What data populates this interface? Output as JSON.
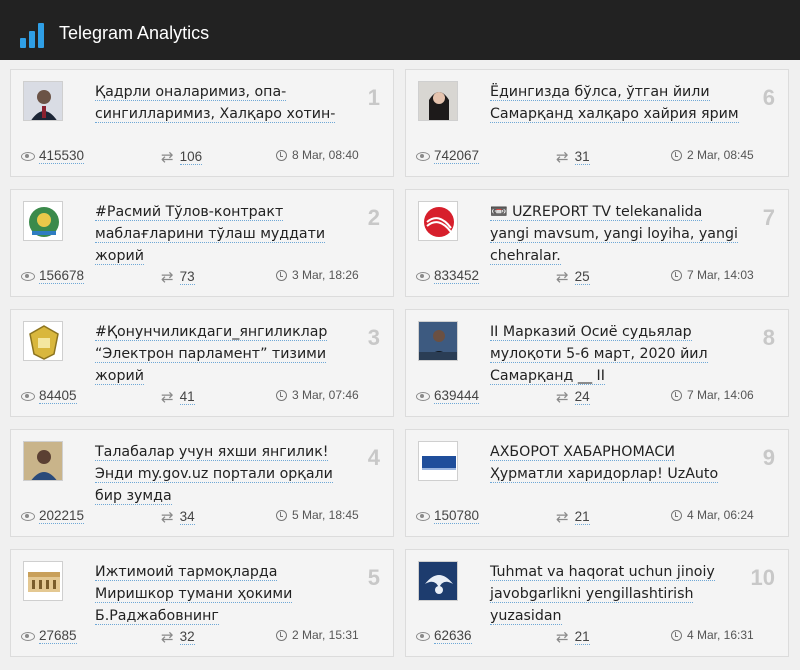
{
  "app": {
    "title": "Telegram Analytics",
    "icon": "bar-chart-icon",
    "accent": "#2f9fe6"
  },
  "posts": [
    {
      "rank": "1",
      "title": "Қадрли оналаримиз, опа-сингилларимиз, Халқаро хотин-",
      "views": "415530",
      "shares": "106",
      "date": "8 Mar, 08:40",
      "thumb": "portrait-photo"
    },
    {
      "rank": "2",
      "title": "#Расмий Тўлов-контракт маблағларини тўлаш муддати жорий",
      "views": "156678",
      "shares": "73",
      "date": "3 Mar, 18:26",
      "thumb": "emblem"
    },
    {
      "rank": "3",
      "title": "#Қонунчиликдаги_янгиликлар “Электрон парламент” тизими жорий",
      "views": "84405",
      "shares": "41",
      "date": "3 Mar, 07:46",
      "thumb": "emblem-yellow"
    },
    {
      "rank": "4",
      "title": "Талабалар учун яхши янгилик! Энди my.gov.uz портали орқали бир зумда",
      "views": "202215",
      "shares": "34",
      "date": "5 Mar, 18:45",
      "thumb": "portrait-photo"
    },
    {
      "rank": "5",
      "title": "Ижтимоий тармоқларда Миришкор тумани ҳокими Б.Раджабовнинг",
      "views": "27685",
      "shares": "32",
      "date": "2 Mar, 15:31",
      "thumb": "building-photo"
    },
    {
      "rank": "6",
      "title": "Ёдингизда бўлса, ўтган йили Самарқанд халқаро хайрия ярим",
      "views": "742067",
      "shares": "31",
      "date": "2 Mar, 08:45",
      "thumb": "portrait-photo"
    },
    {
      "rank": "7",
      "title": "📼 UZREPORT TV telekanalida yangi mavsum, yangi loyiha, yangi chehralar.",
      "views": "833452",
      "shares": "25",
      "date": "7 Mar, 14:03",
      "thumb": "red-logo"
    },
    {
      "rank": "8",
      "title": "II Марказий Осиё судьялар мулоқоти 5-6 март, 2020 йил Самарқанд __ II",
      "views": "639444",
      "shares": "24",
      "date": "7 Mar, 14:06",
      "thumb": "portrait-photo"
    },
    {
      "rank": "9",
      "title": "АХБОРОТ ХАБАРНОМАСИ Ҳурматли харидорлар! UzAuto",
      "views": "150780",
      "shares": "21",
      "date": "4 Mar, 06:24",
      "thumb": "uzauto-logo"
    },
    {
      "rank": "10",
      "title": "Tuhmat va haqorat uchun jinoiy javobgarlikni yengillashtirish yuzasidan",
      "views": "62636",
      "shares": "21",
      "date": "4 Mar, 16:31",
      "thumb": "eagle-logo"
    }
  ]
}
